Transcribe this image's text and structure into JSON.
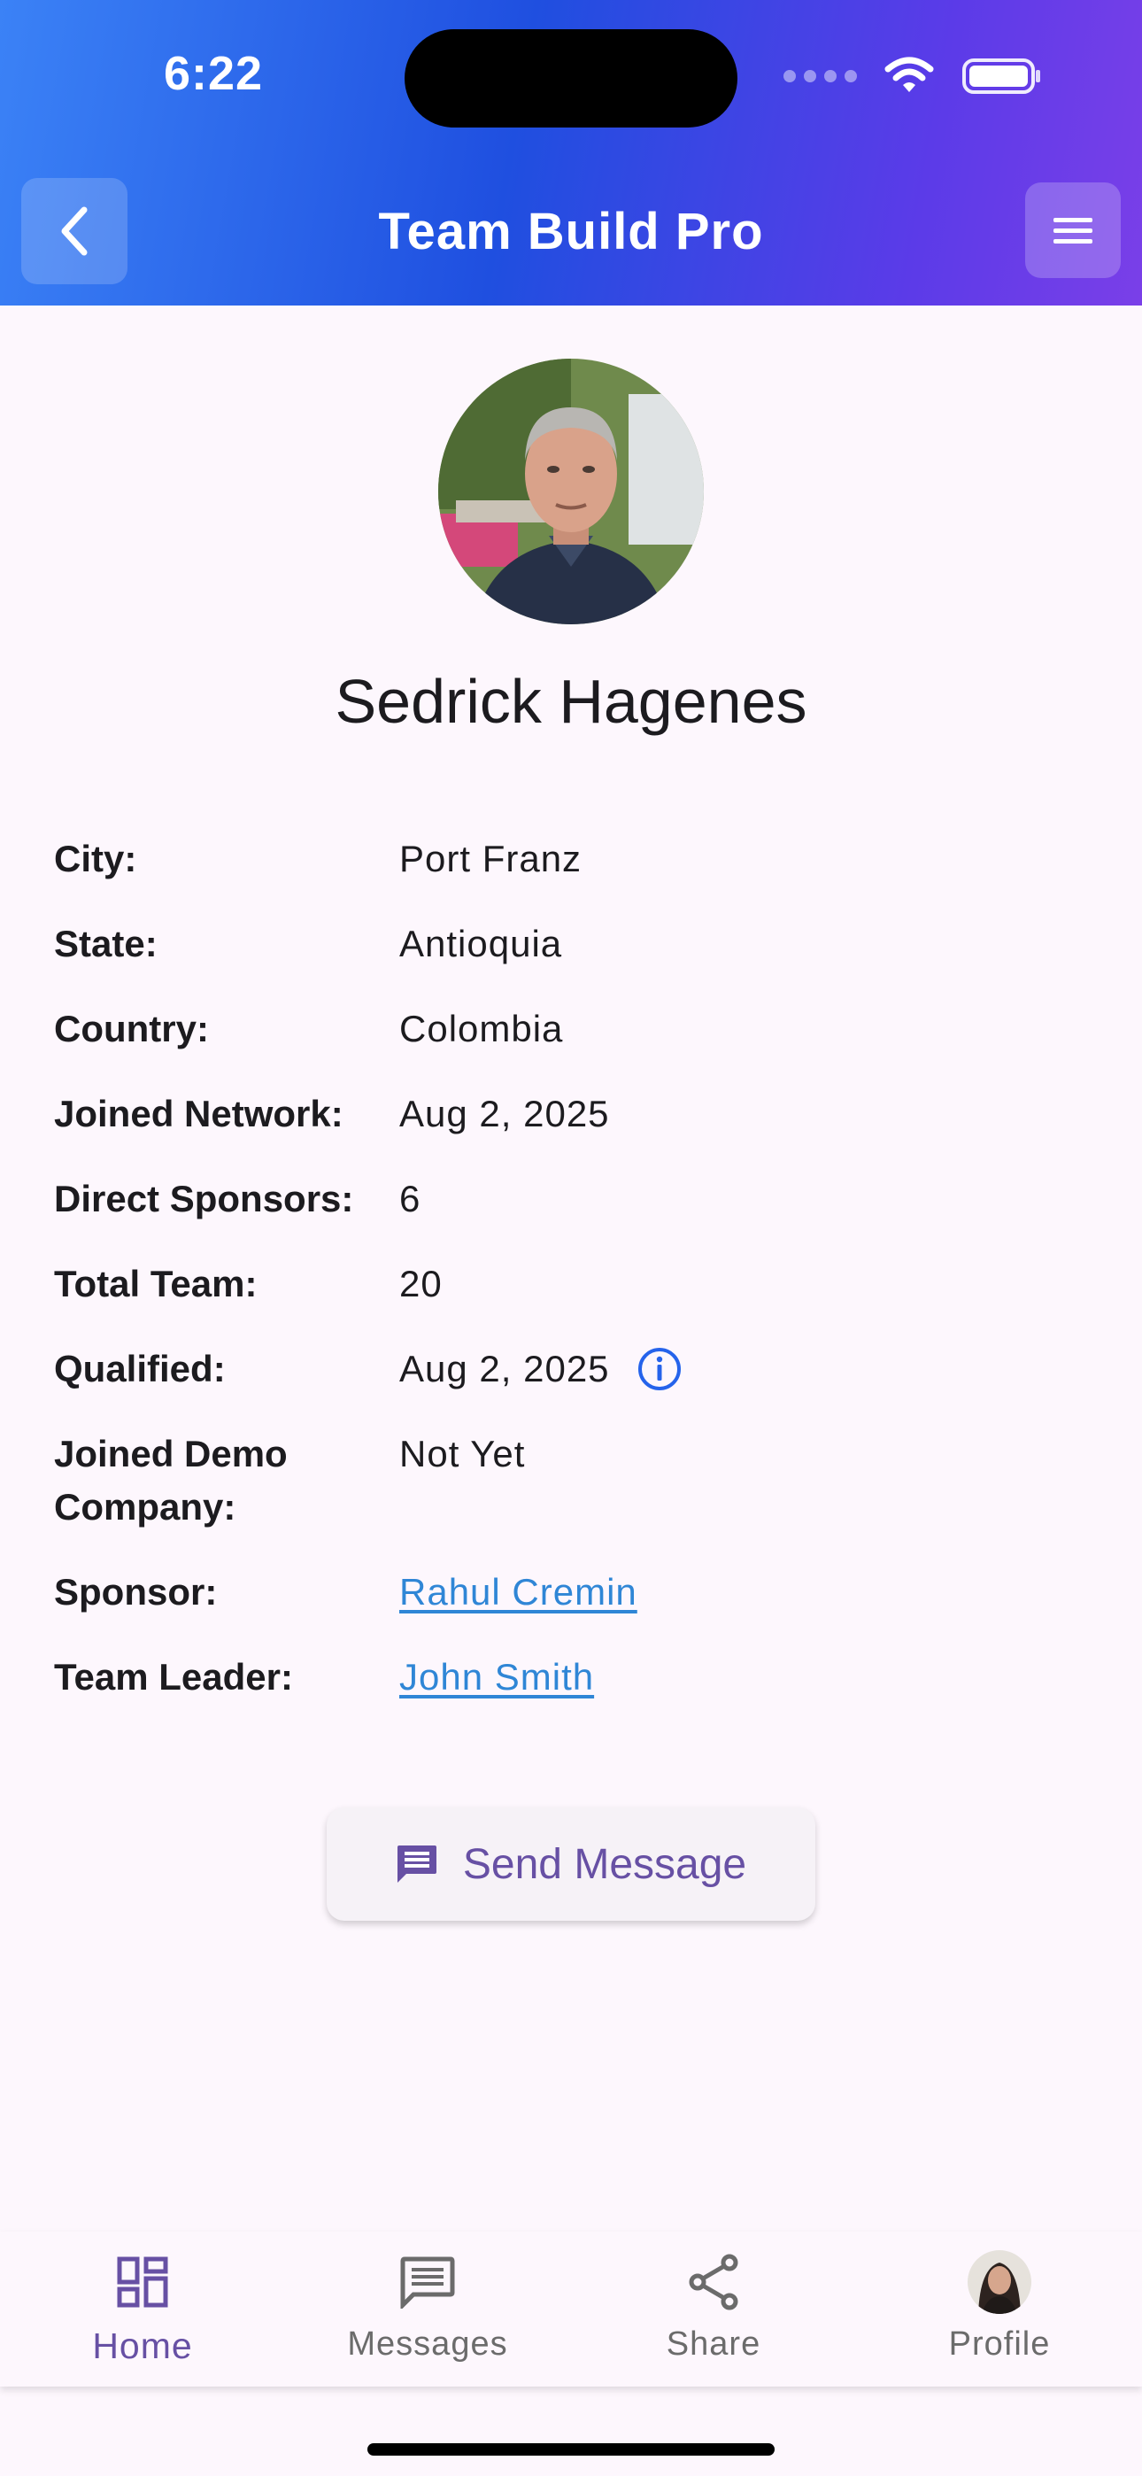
{
  "status_bar": {
    "time": "6:22"
  },
  "app_bar": {
    "title": "Team Build Pro"
  },
  "profile": {
    "name": "Sedrick Hagenes",
    "fields": [
      {
        "label": "City:",
        "value": "Port Franz"
      },
      {
        "label": "State:",
        "value": "Antioquia"
      },
      {
        "label": "Country:",
        "value": "Colombia"
      },
      {
        "label": "Joined Network:",
        "value": "Aug 2, 2025"
      },
      {
        "label": "Direct Sponsors:",
        "value": "6"
      },
      {
        "label": "Total Team:",
        "value": "20"
      },
      {
        "label": "Qualified:",
        "value": "Aug 2, 2025"
      },
      {
        "label": "Joined Demo Company:",
        "value": "Not Yet"
      },
      {
        "label": "Sponsor:",
        "value": "Rahul Cremin"
      },
      {
        "label": "Team Leader:",
        "value": "John Smith"
      }
    ]
  },
  "actions": {
    "send_message": "Send Message"
  },
  "bottom_nav": {
    "items": [
      {
        "label": "Home",
        "icon": "dashboard-icon",
        "active": true
      },
      {
        "label": "Messages",
        "icon": "message-icon",
        "active": false
      },
      {
        "label": "Share",
        "icon": "share-icon",
        "active": false
      },
      {
        "label": "Profile",
        "icon": "avatar",
        "active": false
      }
    ]
  },
  "colors": {
    "accent": "#6750a4",
    "link": "#2f86d6",
    "info_icon": "#2563eb",
    "header_gradient_start": "#3b82f6",
    "header_gradient_end": "#7a3fe8",
    "background": "#fdf7fd"
  }
}
